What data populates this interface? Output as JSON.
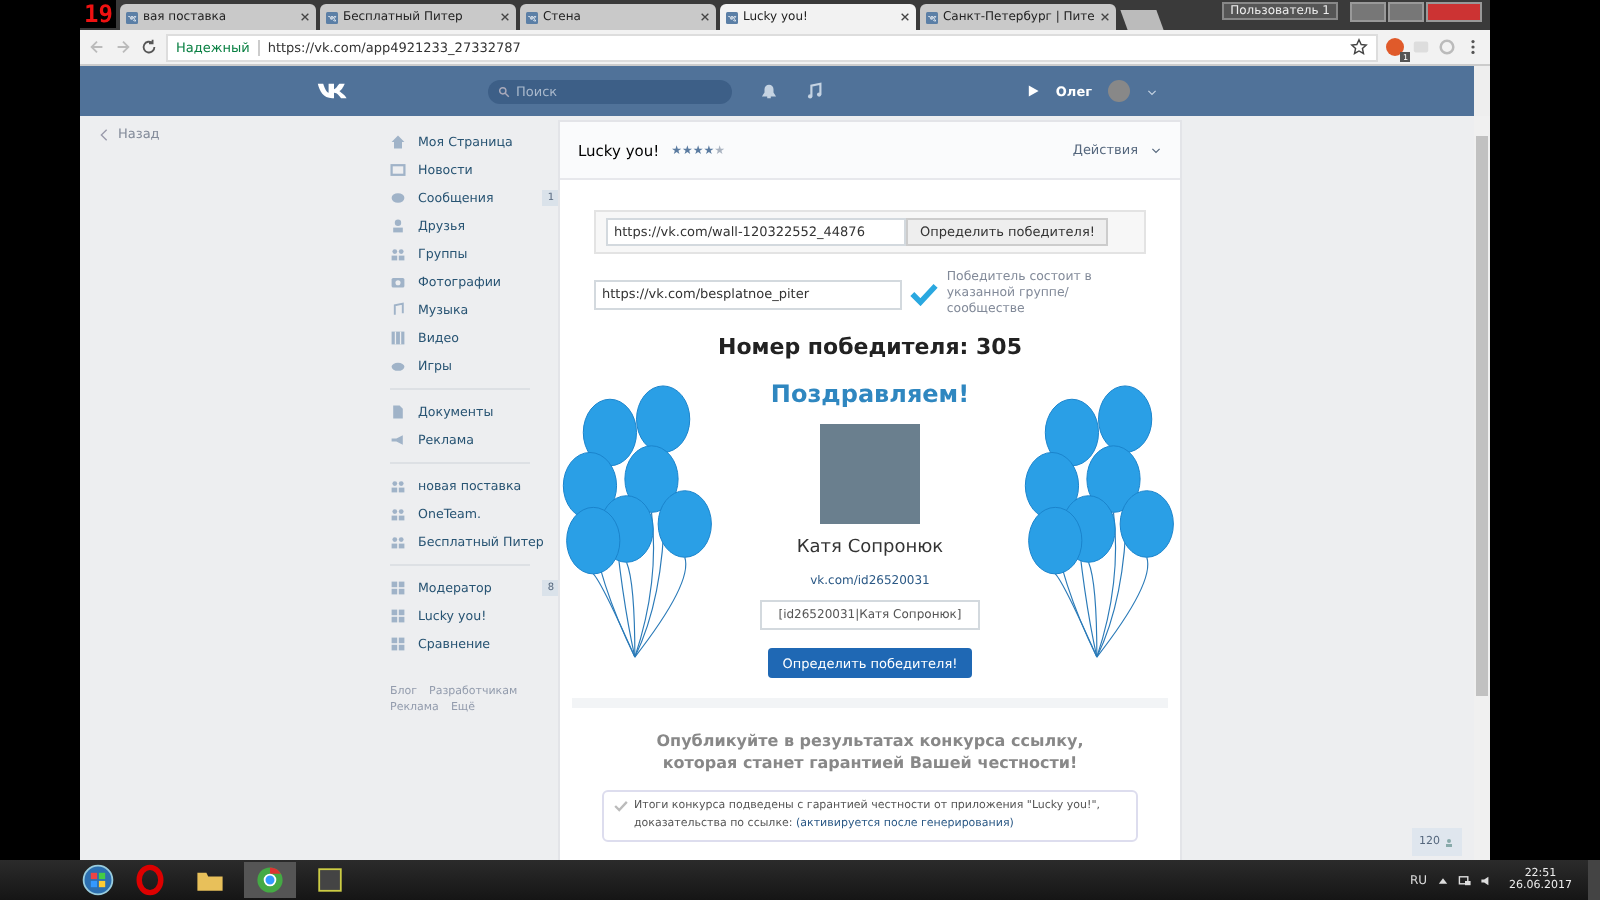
{
  "browser": {
    "counter": "19",
    "tabs": [
      {
        "title": "вая поставка",
        "selected": false
      },
      {
        "title": "Бесплатный Питер",
        "selected": false
      },
      {
        "title": "Стена",
        "selected": false
      },
      {
        "title": "Lucky you!",
        "selected": true
      },
      {
        "title": "Санкт-Петербург | Пите",
        "selected": false
      }
    ],
    "user_button": "Пользователь 1",
    "secure_label": "Надежный",
    "url": "https://vk.com/app4921233_27332787",
    "extension_badge": "1"
  },
  "header": {
    "search_placeholder": "Поиск",
    "user": "Олег"
  },
  "back": "Назад",
  "sidebar": {
    "groups": [
      [
        {
          "kind": "home",
          "label": "Моя Страница"
        },
        {
          "kind": "news",
          "label": "Новости"
        },
        {
          "kind": "messages",
          "label": "Сообщения",
          "count": "1"
        },
        {
          "kind": "friends",
          "label": "Друзья"
        },
        {
          "kind": "groups",
          "label": "Группы"
        },
        {
          "kind": "photos",
          "label": "Фотографии"
        },
        {
          "kind": "music",
          "label": "Музыка"
        },
        {
          "kind": "video",
          "label": "Видео"
        },
        {
          "kind": "games",
          "label": "Игры"
        }
      ],
      [
        {
          "kind": "docs",
          "label": "Документы"
        },
        {
          "kind": "ads",
          "label": "Реклама"
        }
      ],
      [
        {
          "kind": "groups",
          "label": "новая поставка"
        },
        {
          "kind": "groups",
          "label": "OneTeam."
        },
        {
          "kind": "groups",
          "label": "Бесплатный Питер"
        }
      ],
      [
        {
          "kind": "app",
          "label": "Модератор",
          "count": "8"
        },
        {
          "kind": "app",
          "label": "Lucky you!"
        },
        {
          "kind": "app",
          "label": "Сравнение"
        }
      ]
    ],
    "footer_links": [
      "Блог",
      "Разработчикам",
      "Реклама",
      "Ещё"
    ]
  },
  "app": {
    "title": "Lucky you!",
    "stars": 4,
    "actions": "Действия",
    "post_url": "https://vk.com/wall-120322552_44876",
    "determine_button": "Определить победителя!",
    "group_url": "https://vk.com/besplatnoe_piter",
    "group_checked": true,
    "group_note": "Победитель состоит в указанной группе/сообществе",
    "winner_number": "Номер победителя: 305",
    "congrats": "Поздравляем!",
    "winner_name": "Катя Сопронюк",
    "winner_link": "vk.com/id26520031",
    "winner_code": "[id26520031|Катя Сопронюк]",
    "determine_button_2": "Определить победителя!",
    "publish_text": "Опубликуйте в результатах конкурса ссылку, которая станет гарантией Вашей честности!",
    "proof_text": "Итоги конкурса подведены с гарантией честности от приложения \"Lucky you!\", доказательства по ссылке:",
    "proof_link": "(активируется после генерирования)"
  },
  "online_counter": "120",
  "taskbar": {
    "language": "RU",
    "time": "22:51",
    "date": "26.06.2017"
  }
}
